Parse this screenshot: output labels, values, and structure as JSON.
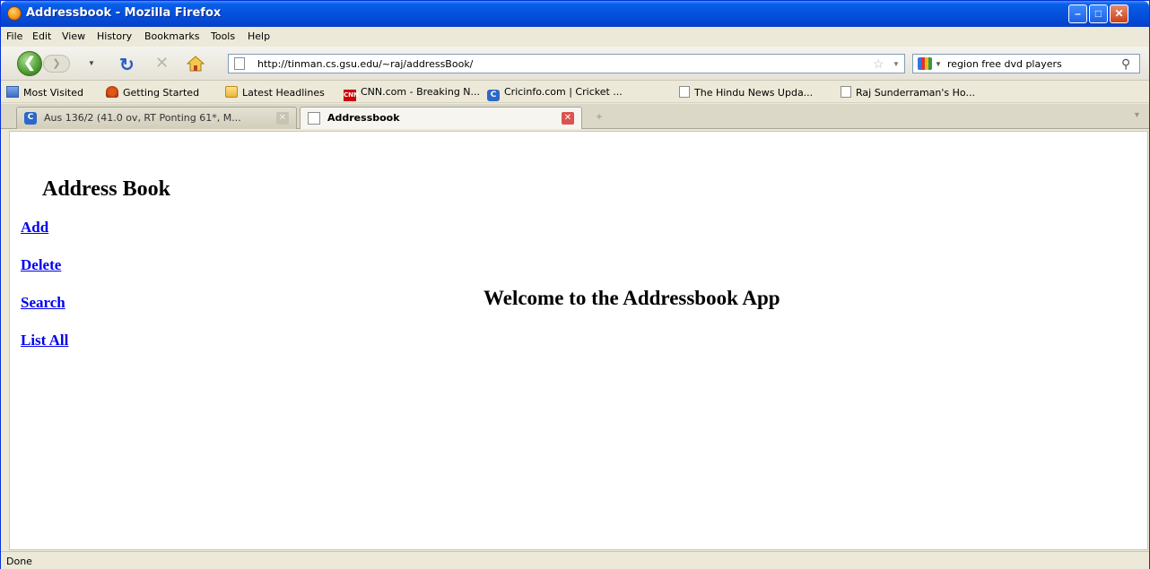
{
  "window": {
    "title": "Addressbook - Mozilla Firefox"
  },
  "menubar": {
    "items": [
      "File",
      "Edit",
      "View",
      "History",
      "Bookmarks",
      "Tools",
      "Help"
    ]
  },
  "navbar": {
    "url": "http://tinman.cs.gsu.edu/~raj/addressBook/",
    "search_value": "region free dvd players"
  },
  "bookmarks": [
    {
      "label": "Most Visited",
      "icon": "most-visited-icon"
    },
    {
      "label": "Getting Started",
      "icon": "getting-started-icon"
    },
    {
      "label": "Latest Headlines",
      "icon": "rss-folder-icon"
    },
    {
      "label": "CNN.com - Breaking N...",
      "icon": "cnn-icon"
    },
    {
      "label": "Cricinfo.com | Cricket ...",
      "icon": "cricinfo-icon"
    },
    {
      "label": "The Hindu News Upda...",
      "icon": "page-icon"
    },
    {
      "label": "Raj Sunderraman's Ho...",
      "icon": "page-icon"
    }
  ],
  "tabs": [
    {
      "label": "Aus 136/2 (41.0 ov, RT Ponting 61*, M...",
      "active": false
    },
    {
      "label": "Addressbook",
      "active": true
    }
  ],
  "page": {
    "title": "Address Book",
    "links": [
      "Add",
      "Delete",
      "Search",
      "List All"
    ],
    "welcome": "Welcome to the Addressbook App"
  },
  "status": {
    "text": "Done"
  },
  "colors": {
    "titlebar": "#0553e0",
    "link": "#0000ee",
    "chrome": "#ece9d8"
  }
}
